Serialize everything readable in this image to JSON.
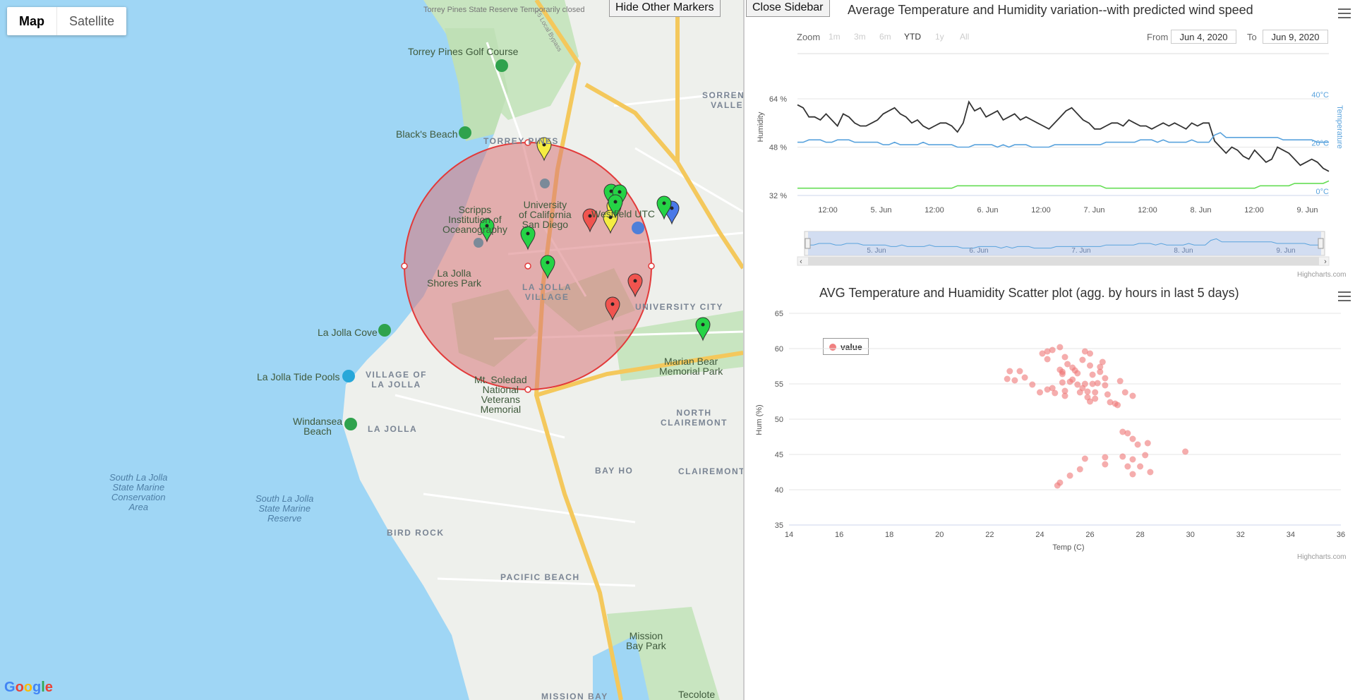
{
  "map": {
    "type_control": {
      "map_label": "Map",
      "satellite_label": "Satellite"
    },
    "hide_markers_label": "Hide Other Markers",
    "close_sidebar_label": "Close Sidebar",
    "google_logo": "Google",
    "labels": {
      "state_reserve": "Torrey Pines\nState Reserve\nTemporarily\nclosed",
      "golf_course": "Torrey Pines Golf Course",
      "blacks_beach": "Black's Beach",
      "torrey_pines": "TORREY PINES",
      "ucsd": "University\nof California\nSan Diego",
      "scripps": "Scripps\nInstitution of\nOceanography",
      "westfield": "Westfield UTC",
      "sorrento_valley": "SORRENTO\nVALLEY",
      "la_jolla_shores": "La Jolla\nShores Park",
      "la_jolla_village": "LA JOLLA\nVILLAGE",
      "university_city": "UNIVERSITY CITY",
      "la_jolla_cove": "La Jolla Cove",
      "tide_pools": "La Jolla Tide Pools",
      "village_of_la_jolla": "VILLAGE OF\nLA JOLLA",
      "mt_soledad": "Mt. Soledad\nNational\nVeterans\nMemorial",
      "marian_bear": "Marian Bear\nMemorial Park",
      "north_clairemont": "NORTH\nCLAIREMONT",
      "windansea": "Windansea\nBeach",
      "la_jolla": "LA JOLLA",
      "bay_ho": "BAY HO",
      "clairemont": "CLAIREMONT",
      "marine_area": "South La Jolla\nState Marine\nConservation\nArea",
      "marine_reserve": "South La Jolla\nState Marine\nReserve",
      "bird_rock": "BIRD ROCK",
      "pacific_beach": "PACIFIC BEACH",
      "mission_bay_park": "Mission\nBay Park",
      "mission_bay": "MISSION BAY",
      "tecolote": "Tecolote",
      "bypass": "I-5 Local Bypass"
    },
    "colors": {
      "water": "#9fd6f5",
      "land": "#eef0ec",
      "park": "#c8e5c0",
      "highway": "#f4c85c",
      "circle_fill": "#d9767a",
      "circle_stroke": "#e23a3a"
    },
    "markers": [
      "yellow",
      "green",
      "green",
      "green",
      "yellow",
      "yellow",
      "red",
      "green",
      "blue",
      "green",
      "green",
      "red",
      "red",
      "green",
      "green"
    ]
  },
  "chart1": {
    "title": "Average Temperature and Humidity variation--with predicted wind speed",
    "zoom_label": "Zoom",
    "zoom_buttons": [
      "1m",
      "3m",
      "6m",
      "YTD",
      "1y",
      "All"
    ],
    "from_label": "From",
    "from_value": "Jun 4, 2020",
    "to_label": "To",
    "to_value": "Jun 9, 2020",
    "y_left_title": "Humidity",
    "y_left_ticks": [
      "64 %",
      "48 %",
      "32 %"
    ],
    "y_right_title": "Temperature",
    "y_right_ticks": [
      "40°C",
      "20°C",
      "0°C"
    ],
    "x_ticks": [
      "12:00",
      "5. Jun",
      "12:00",
      "6. Jun",
      "12:00",
      "7. Jun",
      "12:00",
      "8. Jun",
      "12:00",
      "9. Jun"
    ],
    "navigator_ticks": [
      "5. Jun",
      "6. Jun",
      "7. Jun",
      "8. Jun",
      "9. Jun"
    ],
    "credit": "Highcharts.com",
    "colors": {
      "humidity": "#333333",
      "temperature": "#5aa3dd",
      "wind": "#66dd55"
    }
  },
  "chart_data": [
    {
      "type": "line",
      "title": "Average Temperature and Humidity variation--with predicted wind speed",
      "xlabel": "",
      "x_range": [
        "Jun 4, 2020",
        "Jun 9, 2020"
      ],
      "series": [
        {
          "name": "Humidity",
          "axis": "Humidity (%)",
          "values": [
            62,
            61,
            58,
            58,
            57,
            59,
            57,
            55,
            59,
            58,
            56,
            55,
            55,
            56,
            57,
            59,
            60,
            61,
            59,
            58,
            56,
            57,
            55,
            54,
            55,
            56,
            56,
            55,
            53,
            56,
            63,
            60,
            61,
            58,
            59,
            60,
            57,
            58,
            59,
            57,
            58,
            57,
            56,
            55,
            54,
            56,
            58,
            60,
            61,
            59,
            57,
            56,
            54,
            54,
            55,
            56,
            56,
            55,
            57,
            56,
            55,
            55,
            54,
            55,
            56,
            55,
            56,
            55,
            54,
            56,
            55,
            56,
            56,
            50,
            48,
            46,
            48,
            47,
            45,
            44,
            47,
            45,
            43,
            44,
            48,
            47,
            46,
            44,
            42,
            43,
            44,
            43,
            41,
            40
          ]
        },
        {
          "name": "Temperature",
          "axis": "Temperature (°C)",
          "values": [
            22,
            22,
            23,
            23,
            23,
            22,
            22,
            23,
            23,
            23,
            22,
            22,
            22,
            22,
            22,
            21,
            21,
            22,
            21,
            21,
            21,
            21,
            22,
            21,
            21,
            21,
            21,
            21,
            20,
            20,
            20,
            21,
            21,
            21,
            21,
            20,
            21,
            20,
            21,
            21,
            21,
            20,
            20,
            20,
            20,
            21,
            21,
            21,
            21,
            21,
            21,
            21,
            21,
            21,
            22,
            22,
            22,
            22,
            22,
            22,
            23,
            23,
            23,
            22,
            23,
            22,
            22,
            22,
            22,
            23,
            22,
            22,
            22,
            25,
            26,
            24,
            24,
            24,
            24,
            24,
            24,
            24,
            24,
            24,
            24,
            23,
            23,
            23,
            23,
            23,
            23,
            22,
            22,
            22
          ]
        },
        {
          "name": "Wind speed",
          "values": [
            3,
            3,
            3,
            3,
            3,
            3,
            3,
            3,
            3,
            3,
            3,
            3,
            3,
            3,
            3,
            3,
            3,
            3,
            3,
            3,
            3,
            3,
            3,
            3,
            3,
            3,
            3,
            3,
            4,
            4,
            4,
            4,
            4,
            4,
            4,
            4,
            4,
            4,
            4,
            4,
            4,
            4,
            4,
            4,
            4,
            4,
            4,
            4,
            4,
            4,
            4,
            4,
            4,
            4,
            3,
            3,
            3,
            3,
            3,
            3,
            3,
            3,
            3,
            3,
            3,
            3,
            3,
            3,
            3,
            3,
            3,
            3,
            3,
            3,
            3,
            3,
            3,
            3,
            3,
            3,
            3,
            4,
            4,
            4,
            4,
            4,
            4,
            5,
            5,
            5,
            5,
            5,
            5,
            6
          ]
        }
      ],
      "y_left_range": [
        32,
        64
      ],
      "y_right_range": [
        0,
        40
      ],
      "legend": "none",
      "grid": true
    },
    {
      "type": "scatter",
      "title": "AVG Temperature and Huamidity Scatter plot (agg. by hours in last 5 days)",
      "xlabel": "Temp (C)",
      "ylabel": "Hum (%)",
      "xlim": [
        14,
        36
      ],
      "ylim": [
        35,
        65
      ],
      "x_ticks": [
        "14",
        "16",
        "18",
        "20",
        "22",
        "24",
        "26",
        "28",
        "30",
        "32",
        "34",
        "36"
      ],
      "y_ticks": [
        "65",
        "60",
        "55",
        "50",
        "45",
        "40",
        "35"
      ],
      "legend": "top-left",
      "grid": true,
      "series": [
        {
          "name": "value",
          "color": "#ee7777",
          "points": [
            [
              22.7,
              55.7
            ],
            [
              22.8,
              56.8
            ],
            [
              23.0,
              55.5
            ],
            [
              23.2,
              56.8
            ],
            [
              23.4,
              55.9
            ],
            [
              23.7,
              54.9
            ],
            [
              24.0,
              53.8
            ],
            [
              24.1,
              59.3
            ],
            [
              24.3,
              59.6
            ],
            [
              24.3,
              58.5
            ],
            [
              24.5,
              59.8
            ],
            [
              24.3,
              54.2
            ],
            [
              24.5,
              54.4
            ],
            [
              24.6,
              53.7
            ],
            [
              24.8,
              60.2
            ],
            [
              24.8,
              57.0
            ],
            [
              24.9,
              56.7
            ],
            [
              25.0,
              58.8
            ],
            [
              25.1,
              57.8
            ],
            [
              25.0,
              54.0
            ],
            [
              25.0,
              53.3
            ],
            [
              25.2,
              55.3
            ],
            [
              25.3,
              57.3
            ],
            [
              25.4,
              56.9
            ],
            [
              25.5,
              54.9
            ],
            [
              25.6,
              53.8
            ],
            [
              25.7,
              58.4
            ],
            [
              25.8,
              59.6
            ],
            [
              25.8,
              55.0
            ],
            [
              25.9,
              53.9
            ],
            [
              26.0,
              59.3
            ],
            [
              26.0,
              57.6
            ],
            [
              26.1,
              56.3
            ],
            [
              26.1,
              55.0
            ],
            [
              25.9,
              53.1
            ],
            [
              26.2,
              52.9
            ],
            [
              26.3,
              55.1
            ],
            [
              26.4,
              56.7
            ],
            [
              26.5,
              58.1
            ],
            [
              26.6,
              54.8
            ],
            [
              26.7,
              53.5
            ],
            [
              26.2,
              53.8
            ],
            [
              26.8,
              52.4
            ],
            [
              26.6,
              55.8
            ],
            [
              27.0,
              52.2
            ],
            [
              27.2,
              55.4
            ],
            [
              27.4,
              53.8
            ],
            [
              27.7,
              53.3
            ],
            [
              25.5,
              56.5
            ],
            [
              26.0,
              52.5
            ],
            [
              27.1,
              52.0
            ],
            [
              27.3,
              48.2
            ],
            [
              27.5,
              48.0
            ],
            [
              27.7,
              47.2
            ],
            [
              27.9,
              46.4
            ],
            [
              28.3,
              46.6
            ],
            [
              27.3,
              44.7
            ],
            [
              27.7,
              44.3
            ],
            [
              28.0,
              43.3
            ],
            [
              28.2,
              44.9
            ],
            [
              28.4,
              42.5
            ],
            [
              27.7,
              42.2
            ],
            [
              27.5,
              43.3
            ],
            [
              26.6,
              44.6
            ],
            [
              26.6,
              43.6
            ],
            [
              25.8,
              44.4
            ],
            [
              25.6,
              42.9
            ],
            [
              25.2,
              42.0
            ],
            [
              24.8,
              41.0
            ],
            [
              24.7,
              40.6
            ],
            [
              29.8,
              45.4
            ],
            [
              24.9,
              55.2
            ],
            [
              25.3,
              55.6
            ],
            [
              24.9,
              56.4
            ],
            [
              25.7,
              54.4
            ],
            [
              26.4,
              57.4
            ]
          ]
        }
      ]
    }
  ],
  "chart2": {
    "title": "AVG Temperature and Huamidity Scatter plot (agg. by hours in last 5 days)",
    "legend_label": "value",
    "xlabel": "Temp (C)",
    "ylabel": "Hum (%)",
    "credit": "Highcharts.com"
  }
}
